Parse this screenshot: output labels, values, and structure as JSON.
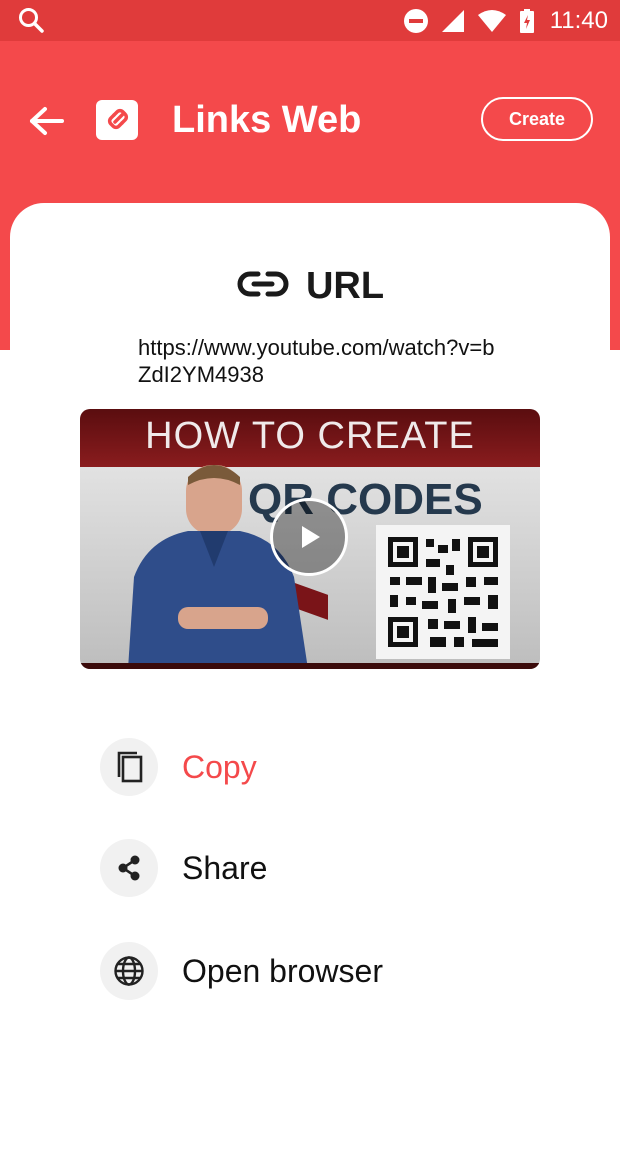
{
  "status_bar": {
    "time": "11:40",
    "icons": [
      "search-icon",
      "do-not-disturb-icon",
      "signal-icon",
      "wifi-icon",
      "battery-icon"
    ]
  },
  "app_bar": {
    "title": "Links Web",
    "create_label": "Create",
    "background": "#f4494b",
    "status_background": "#e03b3b"
  },
  "content": {
    "type_label": "URL",
    "type_icon": "link-icon",
    "url": "https://www.youtube.com/watch?v=bZdI2YM4938",
    "video": {
      "banner_text": "HOW TO CREATE",
      "heading_text": "QR CODES"
    }
  },
  "actions": [
    {
      "label": "Copy",
      "icon": "copy-icon",
      "color": "#f4494b"
    },
    {
      "label": "Share",
      "icon": "share-icon"
    },
    {
      "label": "Open browser",
      "icon": "globe-icon"
    }
  ]
}
